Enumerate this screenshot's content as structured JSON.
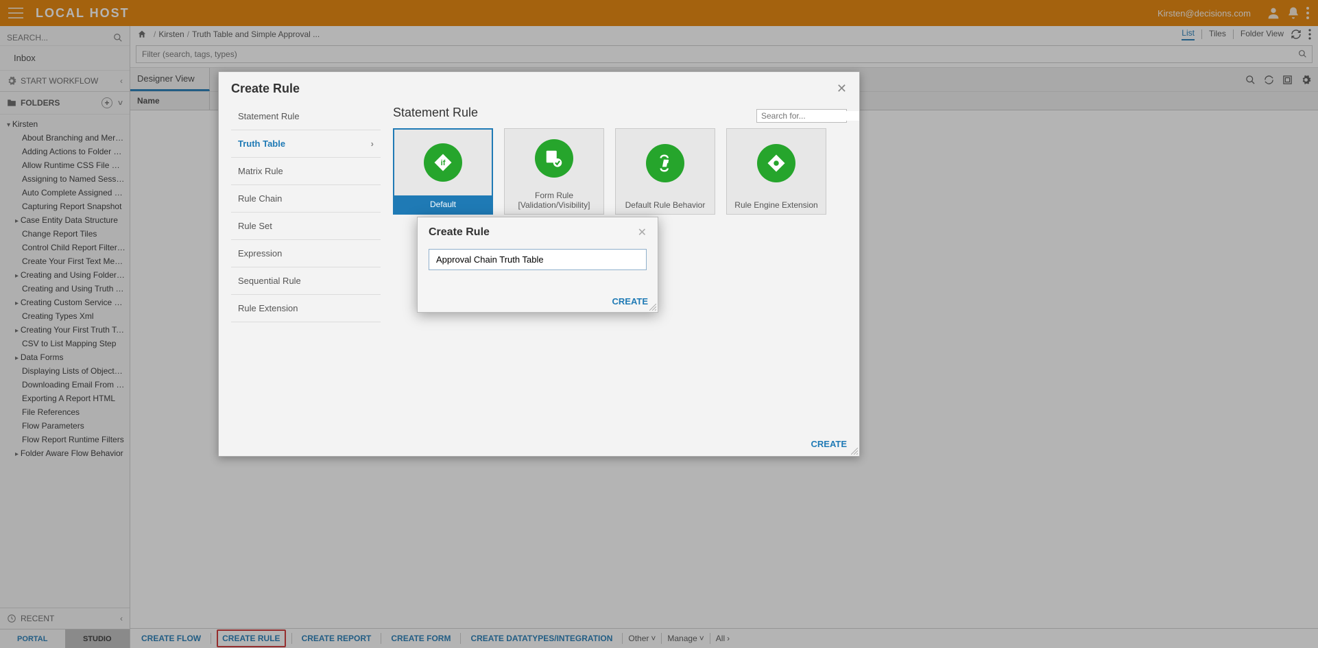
{
  "topbar": {
    "brand": "LOCAL HOST",
    "user": "Kirsten@decisions.com"
  },
  "sidebar": {
    "search_placeholder": "SEARCH...",
    "inbox_label": "Inbox",
    "start_workflow_label": "START WORKFLOW",
    "folders_label": "FOLDERS",
    "root_label": "Kirsten",
    "items": [
      {
        "label": "About Branching and Merging Flows",
        "exp": false
      },
      {
        "label": "Adding Actions to Folder Extensions",
        "exp": false
      },
      {
        "label": "Allow Runtime CSS File Name",
        "exp": false
      },
      {
        "label": "Assigning to Named Sessions",
        "exp": false
      },
      {
        "label": "Auto Complete Assigned Form",
        "exp": false
      },
      {
        "label": "Capturing Report Snapshot",
        "exp": false
      },
      {
        "label": "Case Entity Data Structure",
        "exp": true
      },
      {
        "label": "Change Report Tiles",
        "exp": false
      },
      {
        "label": "Control Child Report Filter Value",
        "exp": false
      },
      {
        "label": "Create Your First Text Merge",
        "exp": false
      },
      {
        "label": "Creating and Using Folder Extensions",
        "exp": true
      },
      {
        "label": "Creating and Using Truth Tables",
        "exp": false
      },
      {
        "label": "Creating Custom Service Catalog",
        "exp": true
      },
      {
        "label": "Creating Types Xml",
        "exp": false
      },
      {
        "label": "Creating Your First Truth Table",
        "exp": true
      },
      {
        "label": "CSV to List Mapping Step",
        "exp": false
      },
      {
        "label": "Data Forms",
        "exp": true
      },
      {
        "label": "Displaying Lists of Objects In A Form",
        "exp": false
      },
      {
        "label": "Downloading Email From a Mail Server",
        "exp": false
      },
      {
        "label": "Exporting A Report HTML",
        "exp": false
      },
      {
        "label": "File References",
        "exp": false
      },
      {
        "label": "Flow Parameters",
        "exp": false
      },
      {
        "label": "Flow Report Runtime Filters",
        "exp": false
      },
      {
        "label": "Folder Aware Flow Behavior",
        "exp": true
      }
    ],
    "recent_label": "RECENT",
    "tab_portal": "PORTAL",
    "tab_studio": "STUDIO"
  },
  "breadcrumbs": {
    "a": "Kirsten",
    "b": "Truth Table and Simple Approval ..."
  },
  "views": {
    "list": "List",
    "tiles": "Tiles",
    "folder": "Folder View"
  },
  "filter": {
    "placeholder": "Filter (search, tags, types)"
  },
  "designer_tab": "Designer View",
  "grid_col_name": "Name",
  "actions": {
    "flow": "CREATE FLOW",
    "rule": "CREATE RULE",
    "report": "CREATE REPORT",
    "form": "CREATE FORM",
    "datatypes": "CREATE DATATYPES/INTEGRATION",
    "other": "Other",
    "manage": "Manage",
    "all": "All"
  },
  "dialog": {
    "title": "Create Rule",
    "categories": [
      "Statement Rule",
      "Truth Table",
      "Matrix Rule",
      "Rule Chain",
      "Rule Set",
      "Expression",
      "Sequential Rule",
      "Rule Extension"
    ],
    "content_title": "Statement Rule",
    "search_placeholder": "Search for...",
    "cards": [
      {
        "label": "Default"
      },
      {
        "label": "Form Rule [Validation/Visibility]"
      },
      {
        "label": "Default Rule Behavior"
      },
      {
        "label": "Rule Engine Extension"
      }
    ],
    "create_btn": "CREATE"
  },
  "dialog_small": {
    "title": "Create Rule",
    "value": "Approval Chain Truth Table",
    "create_btn": "CREATE"
  }
}
